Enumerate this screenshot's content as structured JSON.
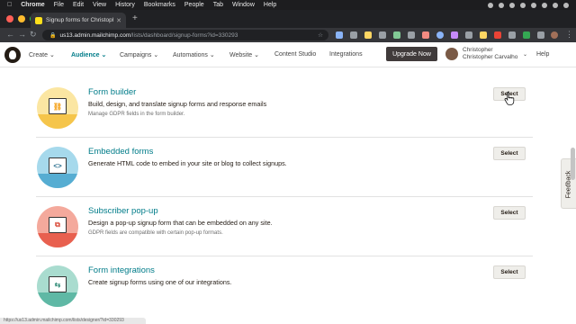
{
  "menubar": {
    "app": "Chrome",
    "items": [
      "File",
      "Edit",
      "View",
      "History",
      "Bookmarks",
      "People",
      "Tab",
      "Window",
      "Help"
    ]
  },
  "browser": {
    "tab_title": "Signup forms for Christopher C",
    "url_host": "us13.admin.mailchimp.com",
    "url_path": "/lists/dashboard/signup-forms?id=330293",
    "status_url": "https://us13.admin.mailchimp.com/lists/designer/?id=330293"
  },
  "nav": {
    "create": "Create",
    "audience": "Audience",
    "campaigns": "Campaigns",
    "automations": "Automations",
    "website": "Website",
    "content_studio": "Content Studio",
    "integrations": "Integrations",
    "upgrade": "Upgrade Now",
    "user_line1": "Christopher",
    "user_line2": "Christopher Carvalho",
    "help": "Help"
  },
  "forms": [
    {
      "title": "Form builder",
      "description": "Build, design, and translate signup forms and response emails",
      "note": "Manage GDPR fields in the form builder.",
      "button": "Select",
      "icon_glyph": "⛓",
      "color_top": "#fbe6a2",
      "color_bottom": "#f5c54b"
    },
    {
      "title": "Embedded forms",
      "description": "Generate HTML code to embed in your site or blog to collect signups.",
      "note": "",
      "button": "Select",
      "icon_glyph": "<>",
      "color_top": "#a6d9ec",
      "color_bottom": "#56add2"
    },
    {
      "title": "Subscriber pop-up",
      "description": "Design a pop-up signup form that can be embedded on any site.",
      "note": "GDPR fields are compatible with certain pop-up formats.",
      "button": "Select",
      "icon_glyph": "⧉",
      "color_top": "#f4a99c",
      "color_bottom": "#e8604f"
    },
    {
      "title": "Form integrations",
      "description": "Create signup forms using one of our integrations.",
      "note": "",
      "button": "Select",
      "icon_glyph": "⇆",
      "color_top": "#a9dccf",
      "color_bottom": "#5fb8a5"
    }
  ],
  "feedback": "Feedback",
  "colors": {
    "teal_link": "#007c89",
    "upgrade_bg": "#403b3b"
  }
}
